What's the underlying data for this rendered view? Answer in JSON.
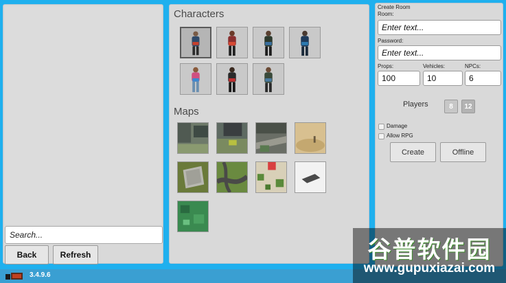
{
  "left_panel": {
    "search_placeholder": "Search...",
    "back_label": "Back",
    "refresh_label": "Refresh"
  },
  "center_panel": {
    "characters_heading": "Characters",
    "maps_heading": "Maps",
    "characters": [
      {
        "name": "character-1",
        "selected": true
      },
      {
        "name": "character-2",
        "selected": false
      },
      {
        "name": "character-3",
        "selected": false
      },
      {
        "name": "character-4",
        "selected": false
      },
      {
        "name": "character-5",
        "selected": false
      },
      {
        "name": "character-6",
        "selected": false
      },
      {
        "name": "character-7",
        "selected": false
      }
    ],
    "maps": [
      {
        "name": "map-city-1"
      },
      {
        "name": "map-city-2"
      },
      {
        "name": "map-city-3"
      },
      {
        "name": "map-desert"
      },
      {
        "name": "map-grass-pad"
      },
      {
        "name": "map-roads"
      },
      {
        "name": "map-village"
      },
      {
        "name": "map-flat-white"
      },
      {
        "name": "map-green-town"
      }
    ]
  },
  "create_room": {
    "title": "Create Room",
    "room_label": "Room:",
    "room_placeholder": "Enter text...",
    "password_label": "Password:",
    "password_placeholder": "Enter text...",
    "props_label": "Props:",
    "props_value": "100",
    "vehicles_label": "Vehicles:",
    "vehicles_value": "10",
    "npcs_label": "NPCs:",
    "npcs_value": "6",
    "players_label": "Players",
    "player_options": [
      "8",
      "12"
    ],
    "selected_players": "12",
    "damage_label": "Damage",
    "allow_rpg_label": "Allow RPG",
    "create_label": "Create",
    "offline_label": "Offline"
  },
  "status": {
    "version": "3.4.9.6"
  },
  "watermark": {
    "main": "谷普软件园",
    "url": "www.gupuxiazai.com"
  }
}
